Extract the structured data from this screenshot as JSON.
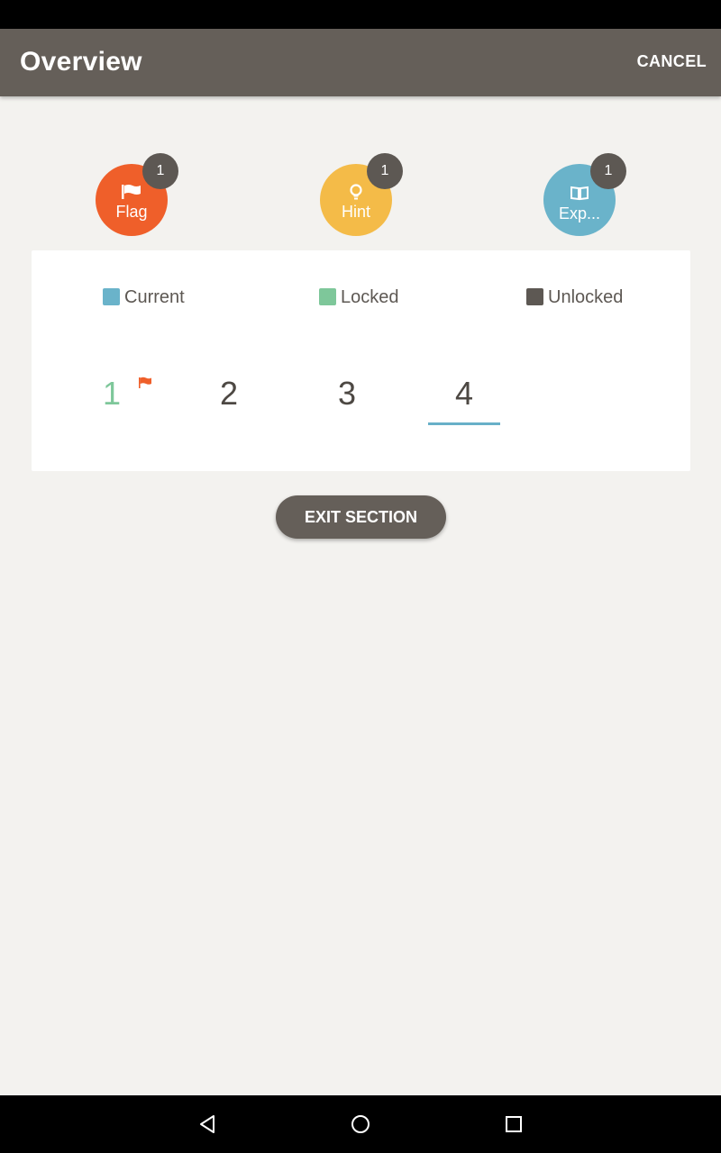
{
  "app_bar": {
    "title": "Overview",
    "cancel_label": "CANCEL"
  },
  "tools": [
    {
      "label": "Flag",
      "count": "1",
      "color": "#ef5f2a",
      "icon": "flag-icon"
    },
    {
      "label": "Hint",
      "count": "1",
      "color": "#f4bb48",
      "icon": "lightbulb-icon"
    },
    {
      "label": "Exp...",
      "count": "1",
      "color": "#6ab3ca",
      "icon": "book-icon"
    }
  ],
  "legend": [
    {
      "label": "Current",
      "color": "#6ab3ca"
    },
    {
      "label": "Locked",
      "color": "#7ec79a"
    },
    {
      "label": "Unlocked",
      "color": "#5d5853"
    }
  ],
  "questions": [
    {
      "number": "1",
      "state": "locked",
      "flagged": true
    },
    {
      "number": "2",
      "state": "unlocked",
      "flagged": false
    },
    {
      "number": "3",
      "state": "unlocked",
      "flagged": false
    },
    {
      "number": "4",
      "state": "current",
      "flagged": false
    }
  ],
  "exit_label": "EXIT SECTION",
  "nav": {
    "back_icon": "back-icon",
    "home_icon": "home-icon",
    "recents_icon": "recents-icon"
  }
}
